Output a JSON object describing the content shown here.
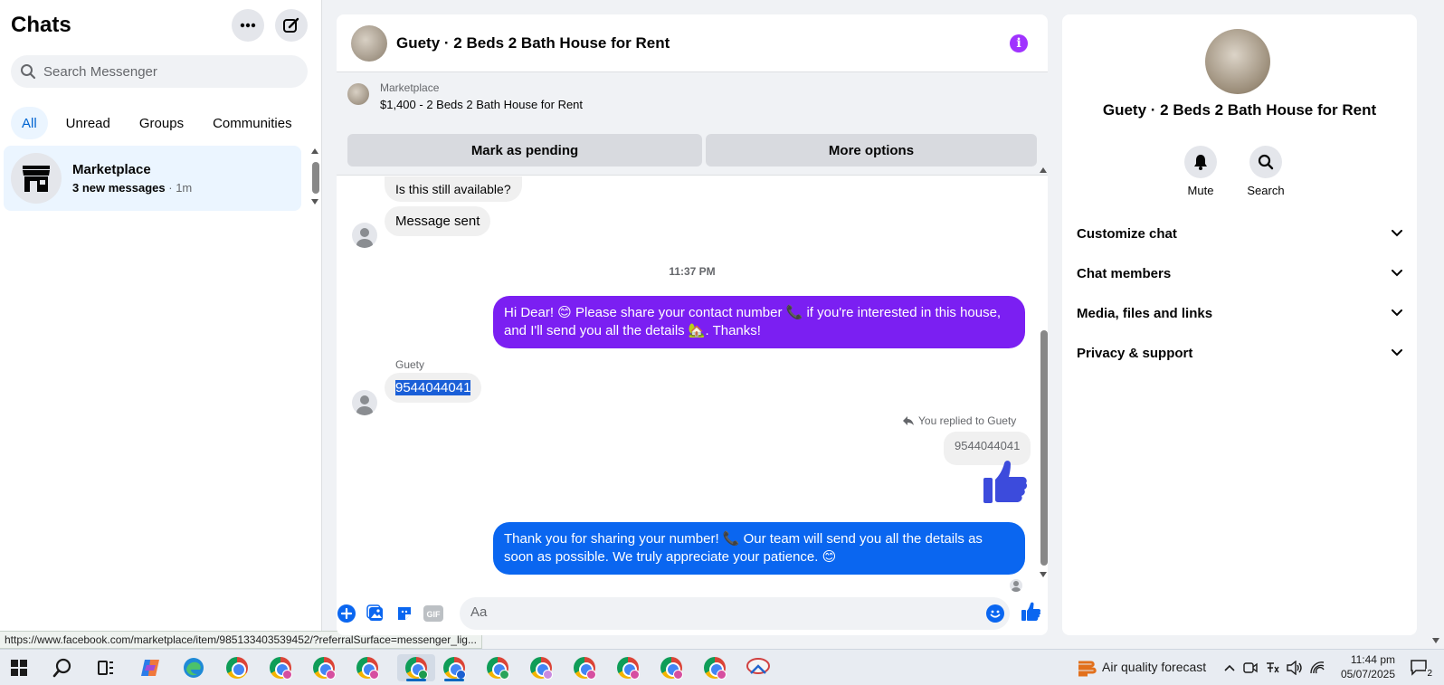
{
  "sidebar": {
    "title": "Chats",
    "search_placeholder": "Search Messenger",
    "filters": [
      "All",
      "Unread",
      "Groups",
      "Communities"
    ],
    "chat": {
      "name": "Marketplace",
      "preview": "3 new messages",
      "time": "· 1m"
    }
  },
  "url_tooltip": "https://www.facebook.com/marketplace/item/985133403539452/?referralSurface=messenger_lig...",
  "header": {
    "title": "Guety · 2 Beds 2 Bath House for Rent"
  },
  "marketplace_bar": {
    "label": "Marketplace",
    "listing": "$1,400 - 2 Beds 2 Bath House for Rent",
    "mark_pending": "Mark as pending",
    "more_options": "More options"
  },
  "messages": {
    "in_1": "Is this still available?",
    "in_2": "Message sent",
    "timestamp": "11:37 PM",
    "out_1": "Hi Dear! 😊 Please share your contact number 📞 if you're interested in this house, and I'll send you all the details 🏡. Thanks!",
    "sender_name": "Guety",
    "in_3": "9544044041",
    "reply_note": "You replied to Guety",
    "reply_quote": "9544044041",
    "out_2": "Thank you for sharing your number! 📞 Our team will send you all the details as soon as possible. We truly appreciate your patience. 😊"
  },
  "composer": {
    "placeholder": "Aa"
  },
  "right_panel": {
    "title": "Guety · 2 Beds 2 Bath House for Rent",
    "mute": "Mute",
    "search": "Search",
    "sections": [
      "Customize chat",
      "Chat members",
      "Media, files and links",
      "Privacy & support"
    ]
  },
  "taskbar": {
    "weather": "Air quality forecast",
    "time": "11:44 pm",
    "date": "05/07/2025",
    "notifications": "2"
  },
  "colors": {
    "accent_blue": "#0a66f0",
    "accent_purple": "#7b1ff2",
    "active_filter": "#0064d1"
  }
}
